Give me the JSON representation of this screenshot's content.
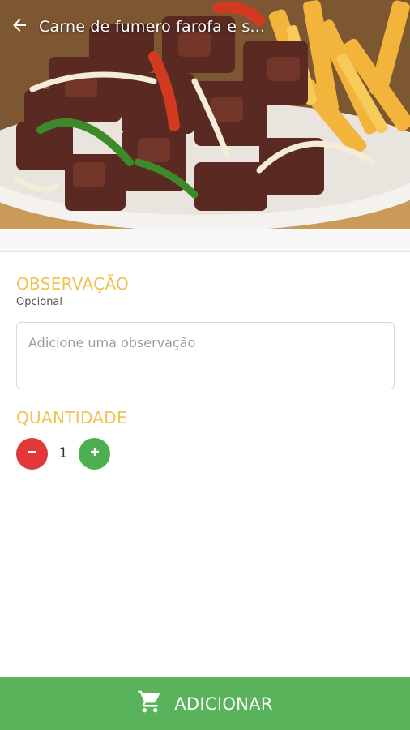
{
  "header": {
    "title": "Carne de fumero farofa e s...",
    "back_icon": "arrow-left-icon"
  },
  "observation": {
    "heading": "OBSERVAÇÃO",
    "subtitle": "Opcional",
    "placeholder": "Adicione uma observação",
    "value": ""
  },
  "quantity": {
    "heading": "QUANTIDADE",
    "value": "1",
    "decrement_icon": "minus-icon",
    "increment_icon": "plus-icon"
  },
  "footer": {
    "add_label": "ADICIONAR",
    "cart_icon": "cart-icon"
  },
  "colors": {
    "accent_heading": "#f0c24f",
    "decrement": "#e2383a",
    "increment": "#4caf50",
    "footer_bar": "#58b35a"
  }
}
